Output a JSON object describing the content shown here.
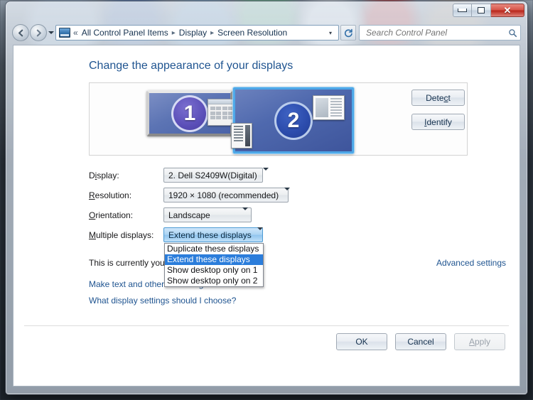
{
  "window": {
    "controls": {
      "minimize": "minimize",
      "maximize": "maximize",
      "close": "✕"
    }
  },
  "navbar": {
    "back": "back",
    "forward": "forward",
    "recent_pages": "▾",
    "breadcrumb": {
      "overflow": "«",
      "items": [
        "All Control Panel Items",
        "Display",
        "Screen Resolution"
      ],
      "separator": "▸",
      "dropdown": "▾"
    },
    "refresh": "↻",
    "search": {
      "placeholder": "Search Control Panel",
      "value": ""
    }
  },
  "page": {
    "title": "Change the appearance of your displays"
  },
  "preview": {
    "monitor1": {
      "number": "1",
      "label": "display-1"
    },
    "monitor2": {
      "number": "2",
      "label": "display-2",
      "selected": true
    }
  },
  "side_buttons": {
    "detect": {
      "pre": "Dete",
      "accel": "c",
      "post": "t"
    },
    "identify": {
      "pre": "",
      "accel": "I",
      "post": "dentify"
    }
  },
  "form": {
    "display": {
      "label_pre": "D",
      "label_accel": "i",
      "label_post": "splay:",
      "value": "2. Dell S2409W(Digital)"
    },
    "resolution": {
      "label_pre": "",
      "label_accel": "R",
      "label_post": "esolution:",
      "value": "1920 × 1080 (recommended)"
    },
    "orientation": {
      "label_pre": "",
      "label_accel": "O",
      "label_post": "rientation:",
      "value": "Landscape"
    },
    "multiple_displays": {
      "label_pre": "",
      "label_accel": "M",
      "label_post": "ultiple displays:",
      "value": "Extend these displays",
      "expanded": true,
      "options": [
        {
          "label": "Duplicate these displays",
          "selected": false
        },
        {
          "label": "Extend these displays",
          "selected": true
        },
        {
          "label": "Show desktop only on 1",
          "selected": false
        },
        {
          "label": "Show desktop only on 2",
          "selected": false
        }
      ]
    }
  },
  "info": {
    "currently_text": "This is currently your main display.",
    "advanced_settings": "Advanced settings",
    "make_text_link": "Make text and other items larger or smaller",
    "what_display_link": "What display settings should I choose?"
  },
  "footer": {
    "ok": "OK",
    "cancel": "Cancel",
    "apply": {
      "pre": "",
      "accel": "A",
      "post": "pply",
      "enabled": false
    }
  },
  "colors": {
    "link": "#1f5490",
    "title": "#1f5490",
    "selection": "#2b7ddb",
    "selected_monitor_border": "#4ea8e8",
    "close_button": "#d6564a"
  }
}
